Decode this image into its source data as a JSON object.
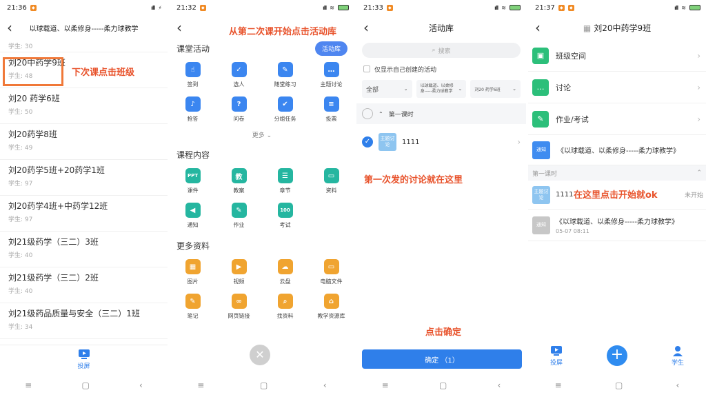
{
  "phone1": {
    "status": {
      "time": "21:36"
    },
    "title": "以球载道、以柔修身-----柔力球教学",
    "top_sub": "学生: 30",
    "classes": [
      {
        "name": "刘20中药学9班",
        "students": "学生: 48"
      },
      {
        "name": "刘20 药学6班",
        "students": "学生: 50"
      },
      {
        "name": "刘20药学8班",
        "students": "学生: 49"
      },
      {
        "name": "刘20药学5班+20药学1班",
        "students": "学生: 97"
      },
      {
        "name": "刘20药学4班+中药学12班",
        "students": "学生: 97"
      },
      {
        "name": "刘21级药学（三二）3班",
        "students": "学生: 40"
      },
      {
        "name": "刘21级药学（三二）2班",
        "students": "学生: 40"
      },
      {
        "name": "刘21级药品质量与安全（三二）1班",
        "students": "学生: 34"
      }
    ],
    "annotation": "下次课点击班级",
    "tab_label": "投屏",
    "icons": {
      "back": "back-arrow-icon",
      "screen": "screen-cast-icon"
    }
  },
  "phone2": {
    "status": {
      "time": "21:32"
    },
    "annotation": "从第二次课开始点击活动库",
    "section1": {
      "title": "课堂活动",
      "button": "活动库"
    },
    "activities": [
      {
        "label": "签到",
        "color": "#3b86f0",
        "glyph": "☝"
      },
      {
        "label": "选人",
        "color": "#3b86f0",
        "glyph": "✓"
      },
      {
        "label": "随堂练习",
        "color": "#3b86f0",
        "glyph": "✎"
      },
      {
        "label": "主题讨论",
        "color": "#3b86f0",
        "glyph": "…"
      },
      {
        "label": "抢答",
        "color": "#3b86f0",
        "glyph": "♪"
      },
      {
        "label": "问卷",
        "color": "#3b86f0",
        "glyph": "?"
      },
      {
        "label": "分组任务",
        "color": "#3b86f0",
        "glyph": "✔"
      },
      {
        "label": "投票",
        "color": "#3b86f0",
        "glyph": "≡"
      }
    ],
    "more_label": "更多",
    "section2": {
      "title": "课程内容"
    },
    "contents": [
      {
        "label": "课件",
        "color": "#25b6a0",
        "glyph": "PPT"
      },
      {
        "label": "教案",
        "color": "#25b6a0",
        "glyph": "教"
      },
      {
        "label": "章节",
        "color": "#25b6a0",
        "glyph": "☰"
      },
      {
        "label": "资料",
        "color": "#25b6a0",
        "glyph": "▭"
      },
      {
        "label": "通知",
        "color": "#25b6a0",
        "glyph": "◀"
      },
      {
        "label": "作业",
        "color": "#25b6a0",
        "glyph": "✎"
      },
      {
        "label": "考试",
        "color": "#25b6a0",
        "glyph": "100"
      }
    ],
    "section3": {
      "title": "更多资料"
    },
    "materials": [
      {
        "label": "图片",
        "color": "#f0a430",
        "glyph": "▦"
      },
      {
        "label": "视频",
        "color": "#f0a430",
        "glyph": "▶"
      },
      {
        "label": "云盘",
        "color": "#f0a430",
        "glyph": "☁"
      },
      {
        "label": "电脑文件",
        "color": "#f0a430",
        "glyph": "▭"
      },
      {
        "label": "笔记",
        "color": "#f0a430",
        "glyph": "✎"
      },
      {
        "label": "网页链接",
        "color": "#f0a430",
        "glyph": "∞"
      },
      {
        "label": "找资料",
        "color": "#f0a430",
        "glyph": "⌕"
      },
      {
        "label": "教学资源库",
        "color": "#f0a430",
        "glyph": "⌂"
      }
    ]
  },
  "phone3": {
    "status": {
      "time": "21:33"
    },
    "title": "活动库",
    "search_placeholder": "搜索",
    "only_mine": "仅显示自己创建的活动",
    "filters": [
      "全部",
      "以球载道、以柔修身-----柔力球教学",
      "刘20 药学6班"
    ],
    "lesson": "第一课时",
    "activity": {
      "tile": "主题讨论",
      "name": "1111"
    },
    "annotation_mid": "第一次发的讨论就在这里",
    "annotation_bottom": "点击确定",
    "confirm": "确定 （1）"
  },
  "phone4": {
    "status": {
      "time": "21:37"
    },
    "title": "刘20中药学9班",
    "features": [
      {
        "label": "班级空间",
        "color": "#2cbf7a",
        "glyph": "▣"
      },
      {
        "label": "讨论",
        "color": "#2cbf7a",
        "glyph": "…"
      },
      {
        "label": "作业/考试",
        "color": "#2cbf7a",
        "glyph": "✎"
      }
    ],
    "notice": {
      "tile": "通知",
      "text": "《以球载道、以柔修身-----柔力球教学》"
    },
    "lesson": "第一课时",
    "activity": {
      "tile": "主题讨论",
      "name": "1111",
      "status": "未开始"
    },
    "annotation": "在这里点击开始就ok",
    "notice2": {
      "tile": "通知",
      "text": "《以球载道、以柔修身-----柔力球教学》",
      "time": "05-07 08:11"
    },
    "tabs": {
      "left": "投屏",
      "right": "学生"
    }
  }
}
